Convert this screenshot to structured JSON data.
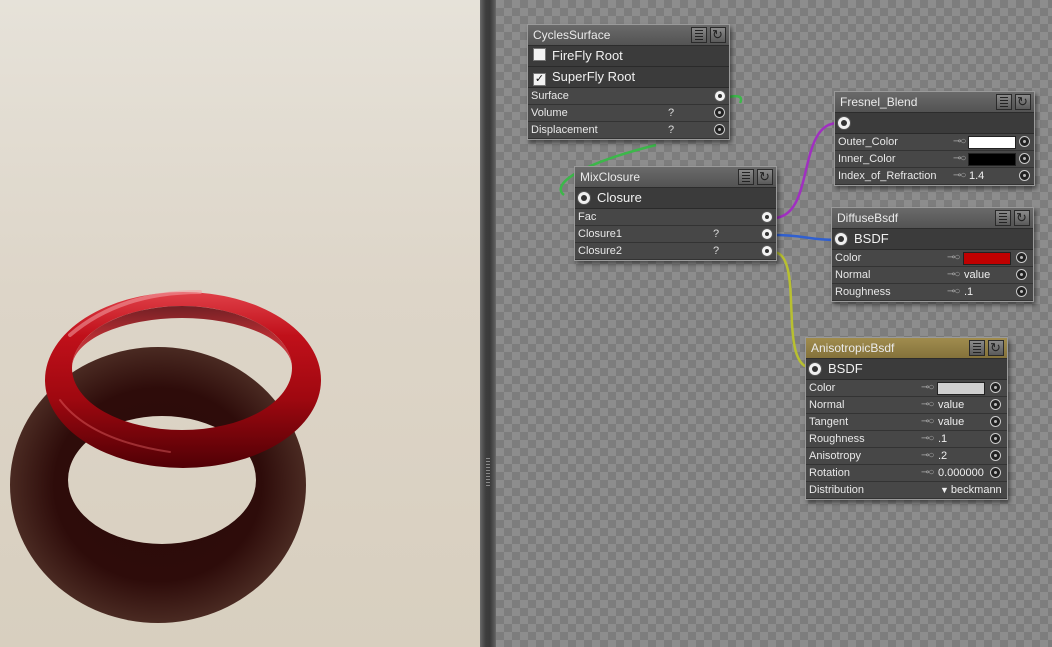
{
  "colors": {
    "canvas_bg": "#8d8d8d",
    "node_body": "#3f3f3f",
    "node_title": "#5e5e5e",
    "anisotropic_title": "#917f45",
    "torus_red": "#c0101a",
    "diffuse_color": "#c00000",
    "outer_color": "#ffffff",
    "inner_color": "#000000",
    "aniso_color": "#d0d0d0",
    "wire_green": "#3cb84a",
    "wire_purple": "#a030c0",
    "wire_blue": "#3060d0",
    "wire_yellow": "#b8c030"
  },
  "icons": {
    "list": "list-icon",
    "swap": "refresh-icon",
    "socket": "socket-icon",
    "key": "key-icon",
    "checkbox": "checkbox-icon"
  },
  "nodes": {
    "cycles_surface": {
      "title": "CyclesSurface",
      "toggles": [
        {
          "label": "FireFly Root",
          "checked": false
        },
        {
          "label": "SuperFly Root",
          "checked": true
        }
      ],
      "check_mark": "✓",
      "rows": [
        {
          "label": "Surface",
          "q": ""
        },
        {
          "label": "Volume",
          "q": "?"
        },
        {
          "label": "Displacement",
          "q": "?"
        }
      ]
    },
    "mix_closure": {
      "title": "MixClosure",
      "output": "Closure",
      "rows": [
        {
          "label": "Fac",
          "q": ""
        },
        {
          "label": "Closure1",
          "q": "?"
        },
        {
          "label": "Closure2",
          "q": "?"
        }
      ]
    },
    "fresnel_blend": {
      "title": "Fresnel_Blend",
      "rows": [
        {
          "label": "Outer_Color",
          "value": ""
        },
        {
          "label": "Inner_Color",
          "value": ""
        },
        {
          "label": "Index_of_Refraction",
          "value": "1.4"
        }
      ]
    },
    "diffuse_bsdf": {
      "title": "DiffuseBsdf",
      "output": "BSDF",
      "rows": [
        {
          "label": "Color",
          "value": ""
        },
        {
          "label": "Normal",
          "value": "value"
        },
        {
          "label": "Roughness",
          "value": ".1"
        }
      ]
    },
    "anisotropic_bsdf": {
      "title": "AnisotropicBsdf",
      "output": "BSDF",
      "rows": [
        {
          "label": "Color",
          "value": ""
        },
        {
          "label": "Normal",
          "value": "value"
        },
        {
          "label": "Tangent",
          "value": "value"
        },
        {
          "label": "Roughness",
          "value": ".1"
        },
        {
          "label": "Anisotropy",
          "value": ".2"
        },
        {
          "label": "Rotation",
          "value": "0.000000"
        },
        {
          "label": "Distribution",
          "value": "beckmann"
        }
      ]
    }
  }
}
